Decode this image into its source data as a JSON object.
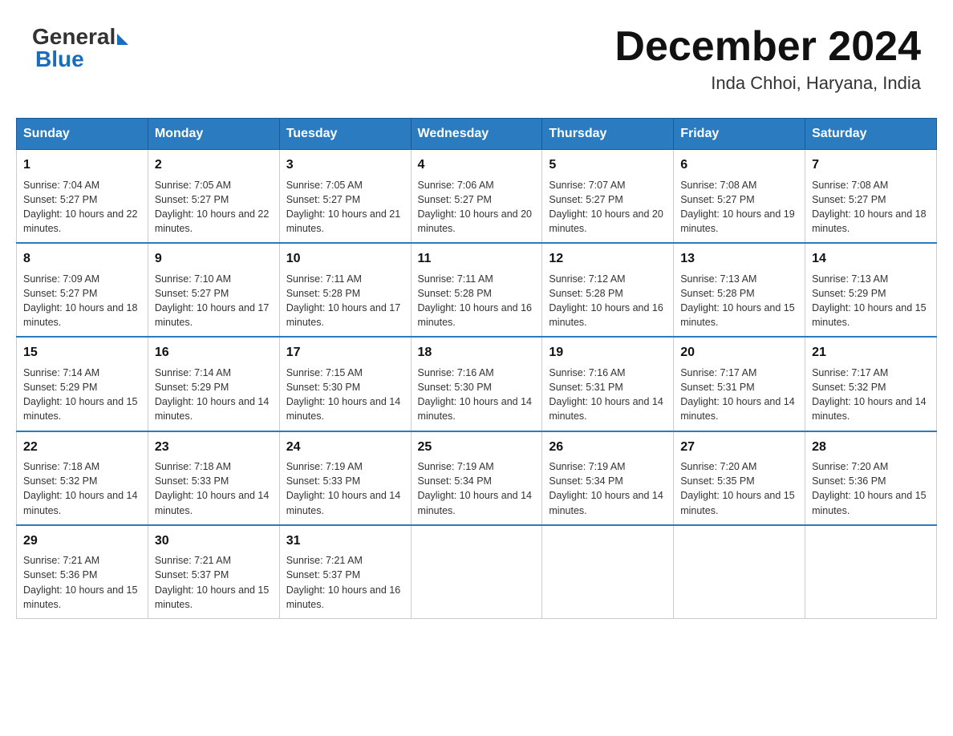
{
  "logo": {
    "general": "General",
    "blue": "Blue"
  },
  "title": "December 2024",
  "location": "Inda Chhoi, Haryana, India",
  "days_of_week": [
    "Sunday",
    "Monday",
    "Tuesday",
    "Wednesday",
    "Thursday",
    "Friday",
    "Saturday"
  ],
  "weeks": [
    [
      {
        "day": "1",
        "sunrise": "7:04 AM",
        "sunset": "5:27 PM",
        "daylight": "10 hours and 22 minutes."
      },
      {
        "day": "2",
        "sunrise": "7:05 AM",
        "sunset": "5:27 PM",
        "daylight": "10 hours and 22 minutes."
      },
      {
        "day": "3",
        "sunrise": "7:05 AM",
        "sunset": "5:27 PM",
        "daylight": "10 hours and 21 minutes."
      },
      {
        "day": "4",
        "sunrise": "7:06 AM",
        "sunset": "5:27 PM",
        "daylight": "10 hours and 20 minutes."
      },
      {
        "day": "5",
        "sunrise": "7:07 AM",
        "sunset": "5:27 PM",
        "daylight": "10 hours and 20 minutes."
      },
      {
        "day": "6",
        "sunrise": "7:08 AM",
        "sunset": "5:27 PM",
        "daylight": "10 hours and 19 minutes."
      },
      {
        "day": "7",
        "sunrise": "7:08 AM",
        "sunset": "5:27 PM",
        "daylight": "10 hours and 18 minutes."
      }
    ],
    [
      {
        "day": "8",
        "sunrise": "7:09 AM",
        "sunset": "5:27 PM",
        "daylight": "10 hours and 18 minutes."
      },
      {
        "day": "9",
        "sunrise": "7:10 AM",
        "sunset": "5:27 PM",
        "daylight": "10 hours and 17 minutes."
      },
      {
        "day": "10",
        "sunrise": "7:11 AM",
        "sunset": "5:28 PM",
        "daylight": "10 hours and 17 minutes."
      },
      {
        "day": "11",
        "sunrise": "7:11 AM",
        "sunset": "5:28 PM",
        "daylight": "10 hours and 16 minutes."
      },
      {
        "day": "12",
        "sunrise": "7:12 AM",
        "sunset": "5:28 PM",
        "daylight": "10 hours and 16 minutes."
      },
      {
        "day": "13",
        "sunrise": "7:13 AM",
        "sunset": "5:28 PM",
        "daylight": "10 hours and 15 minutes."
      },
      {
        "day": "14",
        "sunrise": "7:13 AM",
        "sunset": "5:29 PM",
        "daylight": "10 hours and 15 minutes."
      }
    ],
    [
      {
        "day": "15",
        "sunrise": "7:14 AM",
        "sunset": "5:29 PM",
        "daylight": "10 hours and 15 minutes."
      },
      {
        "day": "16",
        "sunrise": "7:14 AM",
        "sunset": "5:29 PM",
        "daylight": "10 hours and 14 minutes."
      },
      {
        "day": "17",
        "sunrise": "7:15 AM",
        "sunset": "5:30 PM",
        "daylight": "10 hours and 14 minutes."
      },
      {
        "day": "18",
        "sunrise": "7:16 AM",
        "sunset": "5:30 PM",
        "daylight": "10 hours and 14 minutes."
      },
      {
        "day": "19",
        "sunrise": "7:16 AM",
        "sunset": "5:31 PM",
        "daylight": "10 hours and 14 minutes."
      },
      {
        "day": "20",
        "sunrise": "7:17 AM",
        "sunset": "5:31 PM",
        "daylight": "10 hours and 14 minutes."
      },
      {
        "day": "21",
        "sunrise": "7:17 AM",
        "sunset": "5:32 PM",
        "daylight": "10 hours and 14 minutes."
      }
    ],
    [
      {
        "day": "22",
        "sunrise": "7:18 AM",
        "sunset": "5:32 PM",
        "daylight": "10 hours and 14 minutes."
      },
      {
        "day": "23",
        "sunrise": "7:18 AM",
        "sunset": "5:33 PM",
        "daylight": "10 hours and 14 minutes."
      },
      {
        "day": "24",
        "sunrise": "7:19 AM",
        "sunset": "5:33 PM",
        "daylight": "10 hours and 14 minutes."
      },
      {
        "day": "25",
        "sunrise": "7:19 AM",
        "sunset": "5:34 PM",
        "daylight": "10 hours and 14 minutes."
      },
      {
        "day": "26",
        "sunrise": "7:19 AM",
        "sunset": "5:34 PM",
        "daylight": "10 hours and 14 minutes."
      },
      {
        "day": "27",
        "sunrise": "7:20 AM",
        "sunset": "5:35 PM",
        "daylight": "10 hours and 15 minutes."
      },
      {
        "day": "28",
        "sunrise": "7:20 AM",
        "sunset": "5:36 PM",
        "daylight": "10 hours and 15 minutes."
      }
    ],
    [
      {
        "day": "29",
        "sunrise": "7:21 AM",
        "sunset": "5:36 PM",
        "daylight": "10 hours and 15 minutes."
      },
      {
        "day": "30",
        "sunrise": "7:21 AM",
        "sunset": "5:37 PM",
        "daylight": "10 hours and 15 minutes."
      },
      {
        "day": "31",
        "sunrise": "7:21 AM",
        "sunset": "5:37 PM",
        "daylight": "10 hours and 16 minutes."
      },
      null,
      null,
      null,
      null
    ]
  ]
}
